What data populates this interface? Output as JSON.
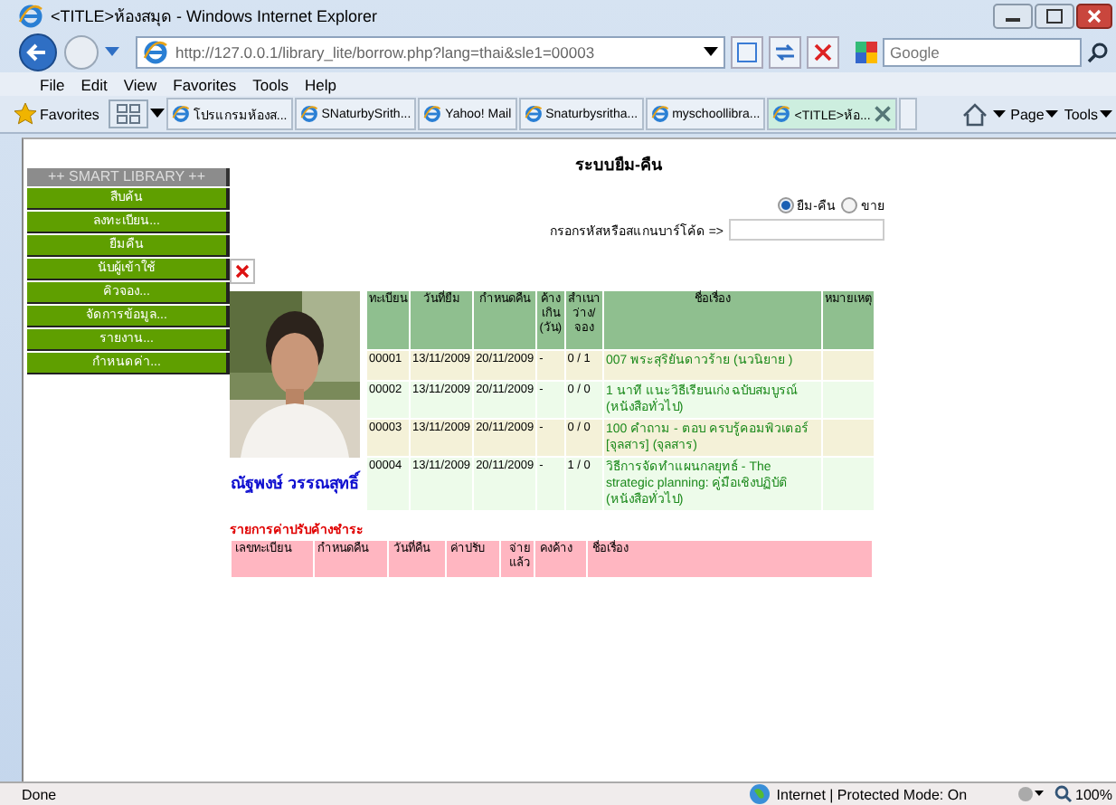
{
  "window": {
    "title": "<TITLE>ห้องสมุด - Windows Internet Explorer"
  },
  "address_bar": {
    "url": "http://127.0.0.1/library_lite/borrow.php?lang=thai&sle1=00003",
    "search_placeholder": "Google"
  },
  "menu": [
    "File",
    "Edit",
    "View",
    "Favorites",
    "Tools",
    "Help"
  ],
  "favorites": {
    "label": "Favorites",
    "tabs": [
      {
        "label": "โปรแกรมห้องส...",
        "selected": false
      },
      {
        "label": "SNaturbySrith...",
        "selected": false
      },
      {
        "label": "Yahoo! Mail",
        "selected": false
      },
      {
        "label": "Snaturbysritha...",
        "selected": false
      },
      {
        "label": "myschoollibra...",
        "selected": false
      },
      {
        "label": "<TITLE>ห้อ...",
        "selected": true
      }
    ],
    "tools": [
      "Page",
      "Tools"
    ]
  },
  "page": {
    "sidebar": {
      "heading": "++ SMART LIBRARY ++",
      "items": [
        "สืบค้น",
        "ลงทะเบียน...",
        "ยืมคืน",
        "นับผู้เข้าใช้",
        "คิวจอง...",
        "จัดการข้อมูล...",
        "รายงาน...",
        "กำหนดค่า..."
      ]
    },
    "title": "ระบบยืม-คืน",
    "modes": [
      {
        "label": "ยืม-คืน",
        "selected": true
      },
      {
        "label": "ขาย",
        "selected": false
      }
    ],
    "barcode_label": "กรอกรหัสหรือสแกนบาร์โค้ด =>",
    "member_name": "ณัฐพงษ์ วรรณสุทธิ์",
    "loans": {
      "columns": [
        "ทะเบียน",
        "วันที่ยืม",
        "กำหนดคืน",
        "ค้างเกิน (วัน)",
        "สำเนา ว่าง/ จอง",
        "ชื่อเรื่อง",
        "หมายเหตุ"
      ],
      "rows": [
        [
          "00001",
          "13/11/2009",
          "20/11/2009",
          "-",
          "0 / 1",
          "007 พระสุริยันดาวร้าย (นวนิยาย )"
        ],
        [
          "00002",
          "13/11/2009",
          "20/11/2009",
          "-",
          "0 / 0",
          "1 นาที แนะวิธีเรียนเก่ง ฉบับสมบูรณ์ (หนังสือทั่วไป)"
        ],
        [
          "00003",
          "13/11/2009",
          "20/11/2009",
          "-",
          "0 / 0",
          "100 คำถาม - ตอบ ครบรู้คอมพิวเตอร์ [จุลสาร] (จุลสาร)"
        ],
        [
          "00004",
          "13/11/2009",
          "20/11/2009",
          "-",
          "1 / 0",
          "วิธีการจัดทำแผนกลยุทธ์ - The strategic planning: คู่มือเชิงปฏิบัติ (หนังสือทั่วไป)"
        ]
      ]
    },
    "fines": {
      "title": "รายการค่าปรับค้างชำระ",
      "columns": [
        "เลขทะเบียน",
        "กำหนดคืน",
        "วันที่คืน",
        "ค่าปรับ",
        "จ่าย แล้ว",
        "คงค้าง",
        "ชื่อเรื่อง"
      ]
    }
  },
  "status_bar": {
    "text": "Done",
    "zone": "Internet | Protected Mode: On",
    "zoom": "100%"
  }
}
